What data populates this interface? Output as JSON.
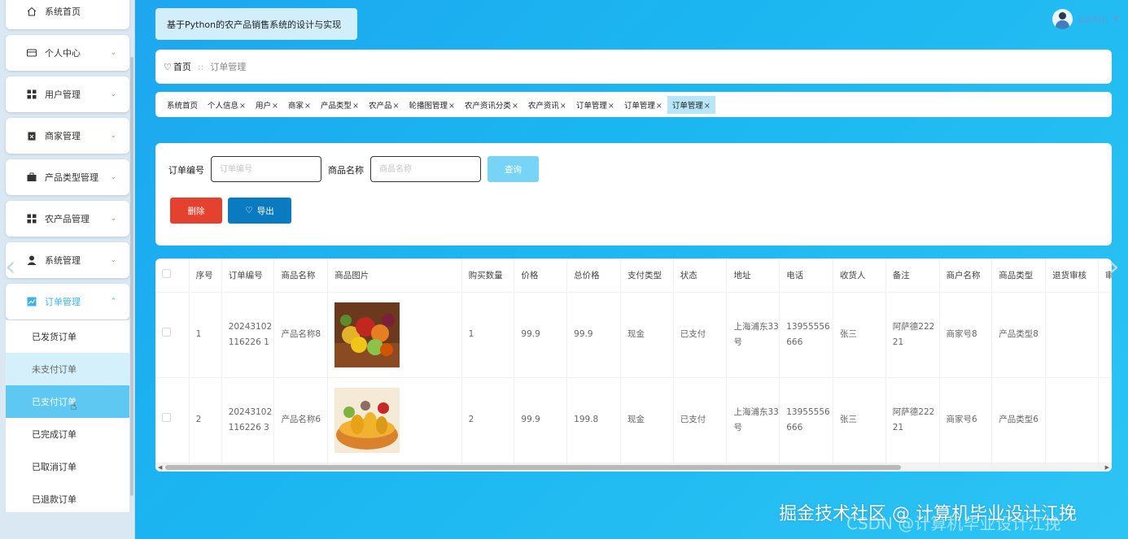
{
  "app": {
    "title": "基于Python的农产品销售系统的设计与实现",
    "user": "admin"
  },
  "sidebar": {
    "items": [
      {
        "label": "系统首页",
        "icon": "home-icon"
      },
      {
        "label": "个人中心",
        "icon": "card-icon"
      },
      {
        "label": "用户管理",
        "icon": "grid-icon"
      },
      {
        "label": "商家管理",
        "icon": "clipboard-icon"
      },
      {
        "label": "产品类型管理",
        "icon": "briefcase-icon"
      },
      {
        "label": "农产品管理",
        "icon": "grid-icon"
      },
      {
        "label": "系统管理",
        "icon": "user-icon"
      },
      {
        "label": "订单管理",
        "icon": "chart-icon"
      }
    ],
    "submenu": [
      "已发货订单",
      "未支付订单",
      "已支付订单",
      "已完成订单",
      "已取消订单",
      "已退款订单"
    ]
  },
  "breadcrumb": {
    "home": "首页",
    "separator": "::",
    "current": "订单管理"
  },
  "tags": [
    "系统首页",
    "个人信息",
    "用户",
    "商家",
    "产品类型",
    "农产品",
    "轮播图管理",
    "农产资讯分类",
    "农产资讯",
    "订单管理",
    "订单管理",
    "订单管理"
  ],
  "search": {
    "order_no_label": "订单编号",
    "order_no_placeholder": "订单编号",
    "product_name_label": "商品名称",
    "product_name_placeholder": "商品名称",
    "query_button": "查询",
    "delete_button": "删除",
    "export_button": "导出"
  },
  "table": {
    "headers": [
      "序号",
      "订单编号",
      "商品名称",
      "商品图片",
      "购买数量",
      "价格",
      "总价格",
      "支付类型",
      "状态",
      "地址",
      "电话",
      "收货人",
      "备注",
      "商户名称",
      "商品类型",
      "退货审核",
      "审核回"
    ],
    "rows": [
      {
        "index": "1",
        "order_no": "20243102116226 1",
        "product": "产品名称8",
        "qty": "1",
        "price": "99.9",
        "total": "99.9",
        "pay_type": "现金",
        "status": "已支付",
        "address": "上海浦东33号",
        "phone": "13955556666",
        "receiver": "张三",
        "remark": "阿萨德22221",
        "merchant": "商家号8",
        "ptype": "产品类型8",
        "return_review": "",
        "review_reply": ""
      },
      {
        "index": "2",
        "order_no": "20243102116226 3",
        "product": "产品名称6",
        "qty": "2",
        "price": "99.9",
        "total": "199.8",
        "pay_type": "现金",
        "status": "已支付",
        "address": "上海浦东33号",
        "phone": "13955556666",
        "receiver": "张三",
        "remark": "阿萨德22221",
        "merchant": "商家号6",
        "ptype": "产品类型6",
        "return_review": "",
        "review_reply": ""
      }
    ]
  },
  "watermark": "掘金技术社区 @ 计算机毕业设计江挽",
  "watermark_sub": "CSDN @计算机毕业设计江挽",
  "colors": {
    "accent": "#3fb1e8",
    "delete": "#e5412f",
    "export": "#0a7bc0",
    "query": "#77d4f6",
    "selected_submenu": "#5fc8f2"
  }
}
